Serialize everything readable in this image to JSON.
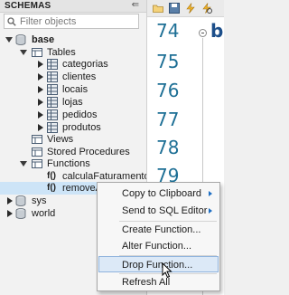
{
  "panel": {
    "title": "SCHEMAS",
    "toggle_icon": "collapse-icon",
    "filter_placeholder": "Filter objects"
  },
  "tree": {
    "schema_base": "base",
    "tables_folder": "Tables",
    "tables": [
      "categorias",
      "clientes",
      "locais",
      "lojas",
      "pedidos",
      "produtos"
    ],
    "views_folder": "Views",
    "procedures_folder": "Stored Procedures",
    "functions_folder": "Functions",
    "function_tag": "f()",
    "functions": [
      "calculaFaturamento",
      "removeAcentos"
    ],
    "other_schemas": [
      "sys",
      "world"
    ]
  },
  "editor": {
    "line_numbers": [
      "74",
      "75",
      "76",
      "77",
      "78",
      "79"
    ],
    "code_fragment": "b"
  },
  "context_menu": {
    "items": [
      {
        "label": "Copy to Clipboard",
        "submenu": true
      },
      {
        "label": "Send to SQL Editor",
        "submenu": true
      },
      {
        "label": "Create Function...",
        "submenu": false
      },
      {
        "label": "Alter Function...",
        "submenu": false
      },
      {
        "label": "Drop Function...",
        "submenu": false
      },
      {
        "label": "Refresh All",
        "submenu": false
      }
    ],
    "hovered_index": 4
  },
  "colors": {
    "accent": "#1d6f95",
    "selection": "#cde4f7",
    "menu_hover": "#dce9f7",
    "table_icon": "#4a5d73"
  }
}
